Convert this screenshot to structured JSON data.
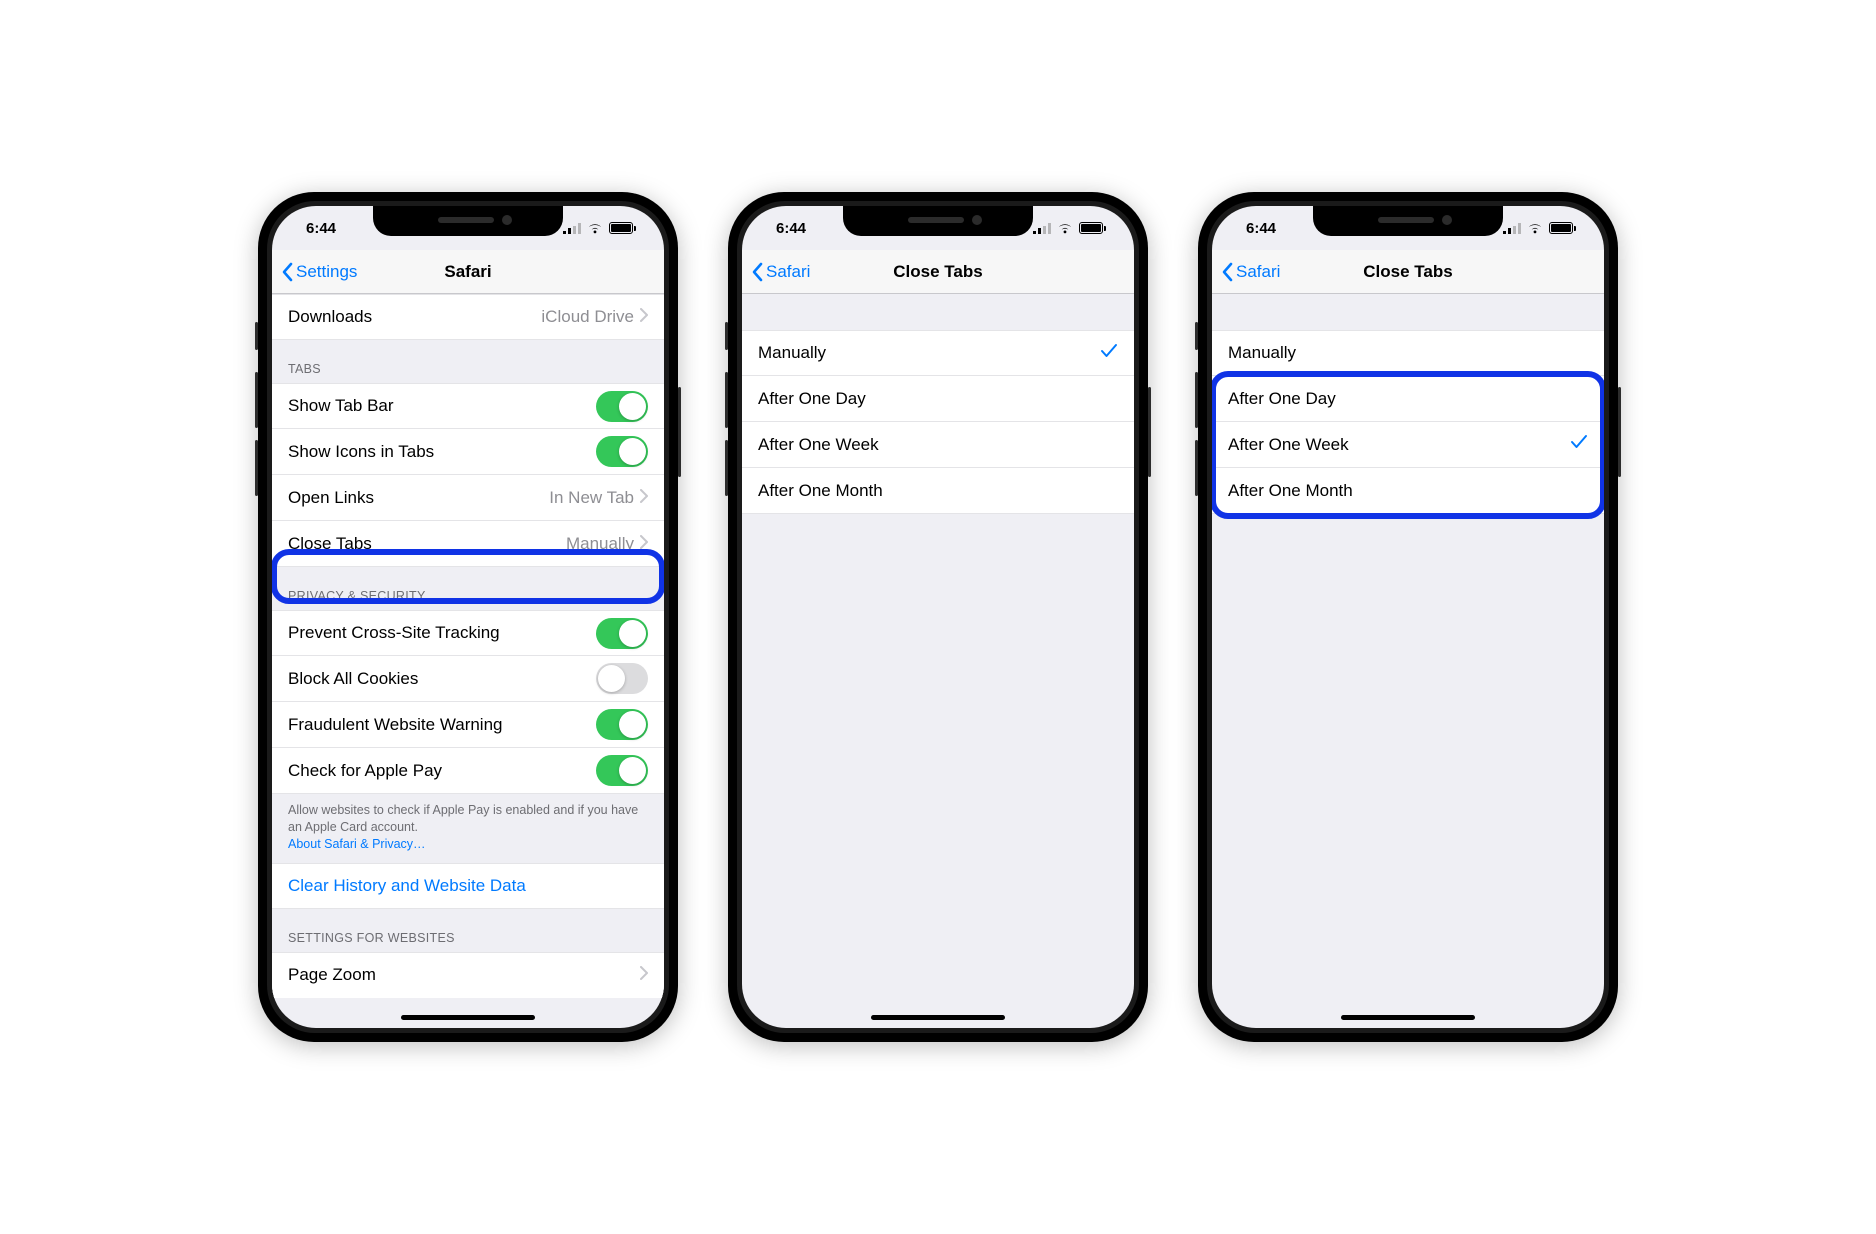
{
  "status": {
    "time": "6:44"
  },
  "colors": {
    "accent": "#007aff",
    "toggle_on": "#34c759",
    "highlight": "#1033e6"
  },
  "screen1": {
    "back": "Settings",
    "title": "Safari",
    "downloads": {
      "label": "Downloads",
      "value": "iCloud Drive"
    },
    "section_tabs_label": "TABS",
    "tabs": {
      "show_tab_bar": "Show Tab Bar",
      "show_icons": "Show Icons in Tabs",
      "open_links": {
        "label": "Open Links",
        "value": "In New Tab"
      },
      "close_tabs": {
        "label": "Close Tabs",
        "value": "Manually"
      }
    },
    "section_privacy_label": "PRIVACY & SECURITY",
    "privacy": {
      "cross_site": "Prevent Cross-Site Tracking",
      "block_cookies": "Block All Cookies",
      "fraud_warning": "Fraudulent Website Warning",
      "apple_pay": "Check for Apple Pay"
    },
    "privacy_footer": "Allow websites to check if Apple Pay is enabled and if you have an Apple Card account.",
    "privacy_footer_link": "About Safari & Privacy…",
    "clear_history": "Clear History and Website Data",
    "section_websites_label": "SETTINGS FOR WEBSITES",
    "page_zoom": "Page Zoom"
  },
  "screen2": {
    "back": "Safari",
    "title": "Close Tabs",
    "options": {
      "manually": "Manually",
      "one_day": "After One Day",
      "one_week": "After One Week",
      "one_month": "After One Month"
    },
    "selected": "manually"
  },
  "screen3": {
    "back": "Safari",
    "title": "Close Tabs",
    "options": {
      "manually": "Manually",
      "one_day": "After One Day",
      "one_week": "After One Week",
      "one_month": "After One Month"
    },
    "selected": "one_week"
  }
}
